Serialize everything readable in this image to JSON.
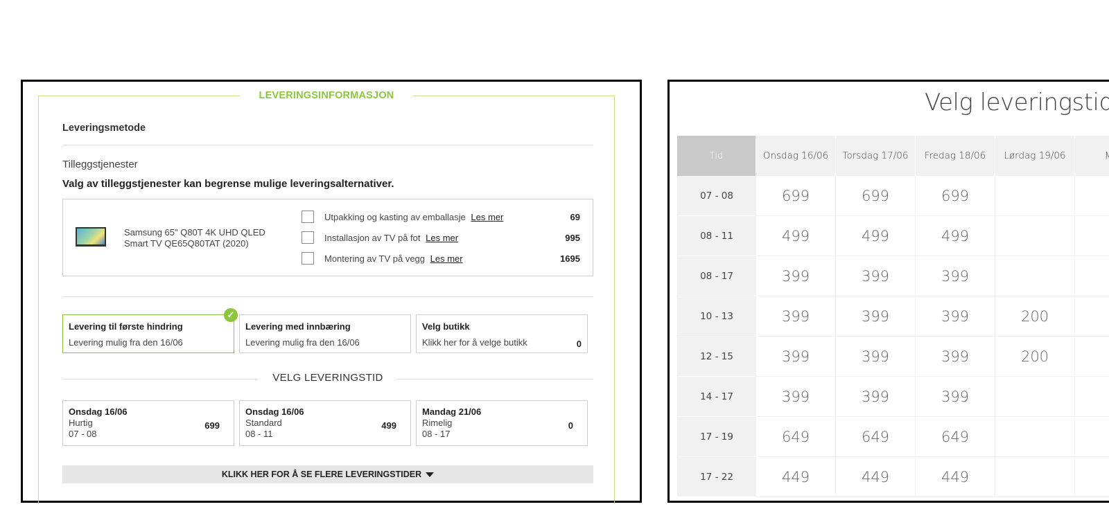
{
  "left": {
    "section_title": "LEVERINGSINFORMASJON",
    "method_label": "Leveringsmetode",
    "addons_title": "Tilleggstjenester",
    "addons_warning": "Valg av tilleggstjenester kan begrense mulige leveringsalternativer.",
    "product": {
      "name": "Samsung 65\" Q80T 4K UHD QLED Smart TV QE65Q80TAT (2020)",
      "thumb_icon": "tv-thumbnail"
    },
    "services": [
      {
        "label": "Utpakking og kasting av emballasje",
        "link": "Les mer",
        "price": "69"
      },
      {
        "label": "Installasjon av TV på fot",
        "link": "Les mer",
        "price": "995"
      },
      {
        "label": "Montering av TV på vegg",
        "link": "Les mer",
        "price": "1695"
      }
    ],
    "delivery_options": [
      {
        "title": "Levering til første hindring",
        "subtitle": "Levering mulig fra den 16/06",
        "price": "",
        "selected": true
      },
      {
        "title": "Levering med innbæring",
        "subtitle": "Levering mulig fra den 16/06",
        "price": "",
        "selected": false
      },
      {
        "title": "Velg butikk",
        "subtitle": "Klikk her for å velge butikk",
        "price": "0",
        "selected": false
      }
    ],
    "pick_time_title": "VELG LEVERINGSTID",
    "time_slots": [
      {
        "day": "Onsdag 16/06",
        "type": "Hurtig",
        "time": "07 - 08",
        "price": "699"
      },
      {
        "day": "Onsdag 16/06",
        "type": "Standard",
        "time": "08 - 11",
        "price": "499"
      },
      {
        "day": "Mandag 21/06",
        "type": "Rimelig",
        "time": "08 - 17",
        "price": "0"
      }
    ],
    "more_times": "KLIKK HER FOR Å SE FLERE LEVERINGSTIDER",
    "accent_color": "#8cc63f"
  },
  "right": {
    "title": "Velg leveringstid",
    "headers": [
      "Tid",
      "Onsdag 16/06",
      "Torsdag 17/06",
      "Fredag 18/06",
      "Lørdag 19/06",
      "Man"
    ],
    "rows": [
      {
        "time": "07 - 08",
        "prices": [
          "699",
          "699",
          "699",
          "",
          ""
        ]
      },
      {
        "time": "08 - 11",
        "prices": [
          "499",
          "499",
          "499",
          "",
          ""
        ]
      },
      {
        "time": "08 - 17",
        "prices": [
          "399",
          "399",
          "399",
          "",
          ""
        ]
      },
      {
        "time": "10 - 13",
        "prices": [
          "399",
          "399",
          "399",
          "200",
          ""
        ]
      },
      {
        "time": "12 - 15",
        "prices": [
          "399",
          "399",
          "399",
          "200",
          ""
        ]
      },
      {
        "time": "14 - 17",
        "prices": [
          "399",
          "399",
          "399",
          "",
          ""
        ]
      },
      {
        "time": "17 - 19",
        "prices": [
          "649",
          "649",
          "649",
          "",
          ""
        ]
      },
      {
        "time": "17 - 22",
        "prices": [
          "449",
          "449",
          "449",
          "",
          ""
        ]
      }
    ]
  }
}
